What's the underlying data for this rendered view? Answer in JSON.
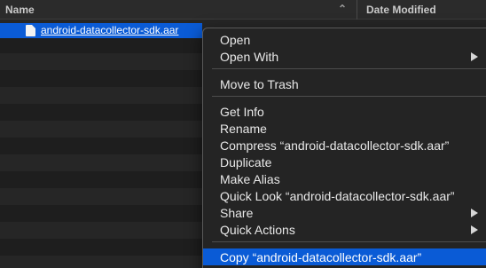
{
  "header": {
    "name_label": "Name",
    "date_label": "Date Modified",
    "sort_glyph": "⌃"
  },
  "file": {
    "name": "android-datacollector-sdk.aar",
    "icon": "document-icon"
  },
  "context_menu": {
    "items": [
      {
        "label": "Open"
      },
      {
        "label": "Open With",
        "submenu": true
      },
      {
        "label": "Move to Trash"
      },
      {
        "label": "Get Info"
      },
      {
        "label": "Rename"
      },
      {
        "label": "Compress “android-datacollector-sdk.aar”"
      },
      {
        "label": "Duplicate"
      },
      {
        "label": "Make Alias"
      },
      {
        "label": "Quick Look “android-datacollector-sdk.aar”"
      },
      {
        "label": "Share",
        "submenu": true
      },
      {
        "label": "Quick Actions",
        "submenu": true
      },
      {
        "label": "Copy “android-datacollector-sdk.aar”",
        "highlighted": true
      }
    ]
  },
  "colors": {
    "selection": "#0a5bd6",
    "menu_background": "#242424",
    "window_background": "#1e1e1e"
  }
}
